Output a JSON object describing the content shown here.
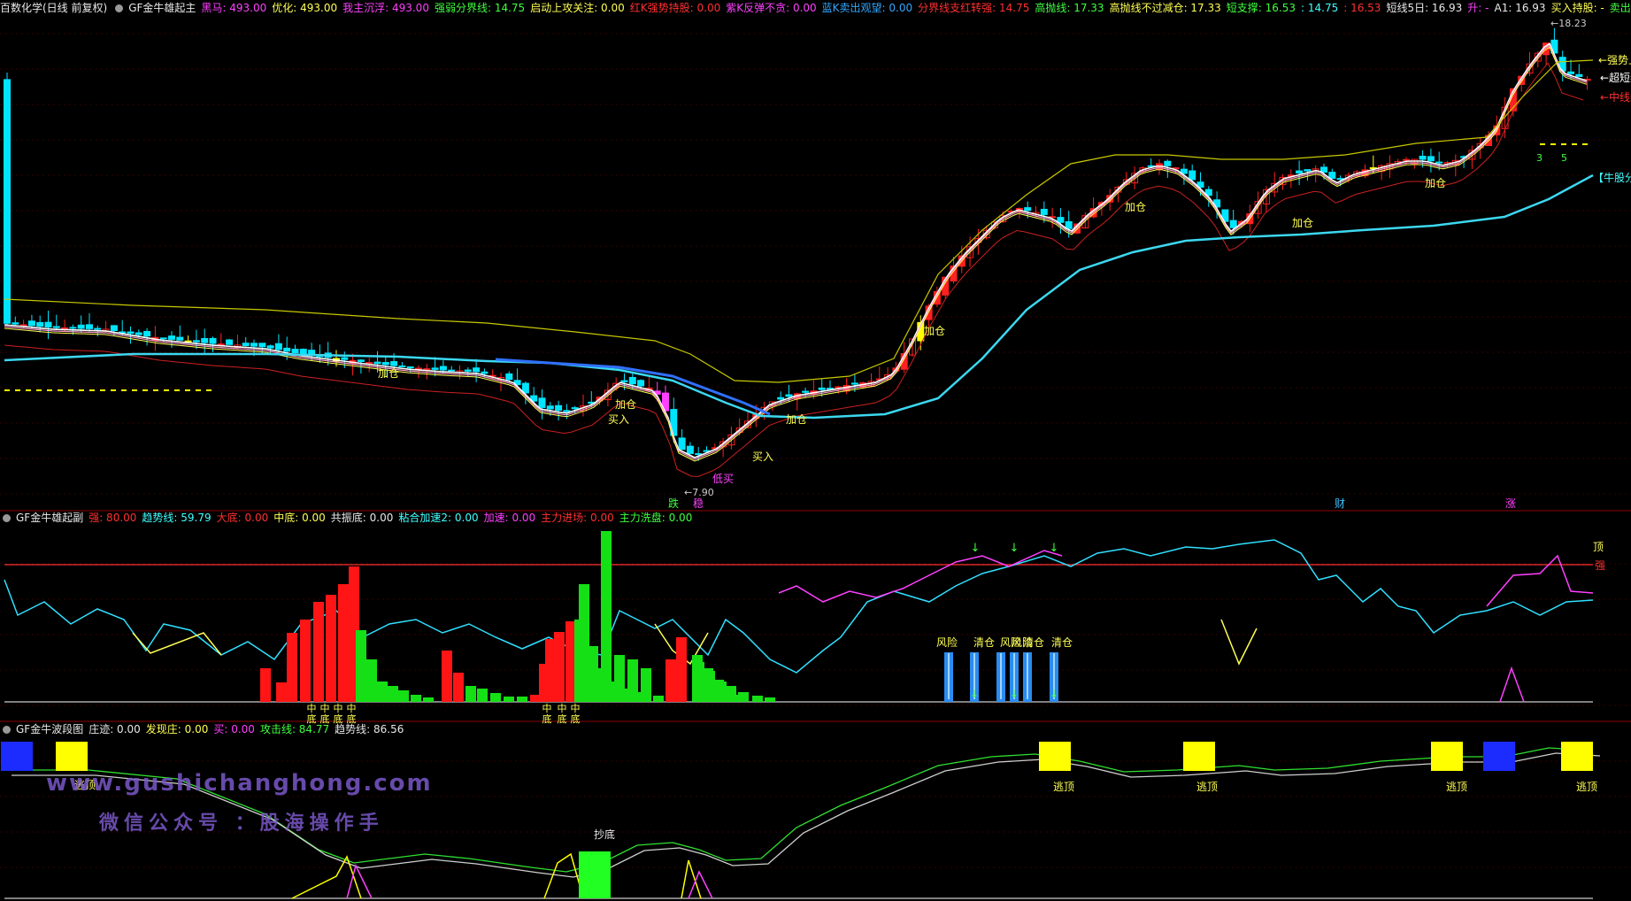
{
  "panel1": {
    "header": [
      {
        "text": "百数化学(日线 前复权)",
        "color": "#e8e8e8"
      },
      {
        "text": "GF金牛雄起主",
        "color": "#e8e8e8",
        "icon": true
      },
      {
        "text": "黑马: 493.00",
        "color": "#ff40ff"
      },
      {
        "text": "优化: 493.00",
        "color": "#ffff55"
      },
      {
        "text": "我主沉浮: 493.00",
        "color": "#ff40ff"
      },
      {
        "text": "强弱分界线: 14.75",
        "color": "#40ff40"
      },
      {
        "text": "启动上攻关注: 0.00",
        "color": "#ffff55"
      },
      {
        "text": "红K强势持股: 0.00",
        "color": "#ff3030"
      },
      {
        "text": "紫K反弹不贪: 0.00",
        "color": "#ff40ff"
      },
      {
        "text": "蓝K卖出观望: 0.00",
        "color": "#30a8ff"
      },
      {
        "text": "分界线支红转强: 14.75",
        "color": "#ff3030"
      },
      {
        "text": "高抛线: 17.33",
        "color": "#40ff40"
      },
      {
        "text": "高抛线不过减仓: 17.33",
        "color": "#ffff55"
      },
      {
        "text": "短支撑: 16.53",
        "color": "#40ff40"
      },
      {
        "text": ": 14.75",
        "color": "#40ffff"
      },
      {
        "text": ": 16.53",
        "color": "#ff3030"
      },
      {
        "text": "短线5日: 16.93",
        "color": "#e8e8e8"
      },
      {
        "text": "升: -",
        "color": "#ff40ff"
      },
      {
        "text": "A1: 16.93",
        "color": "#e8e8e8"
      },
      {
        "text": "买入持股: -",
        "color": "#ffff55"
      },
      {
        "text": "卖出空仓: -",
        "color": "#40ff40"
      }
    ],
    "labels": {
      "jiacang": "加仓",
      "mairu": "买入",
      "dimai": "低买",
      "diancang": "加仓",
      "low_price": "7.90",
      "high_price": "18.23",
      "die": "跌",
      "wen": "稳",
      "cai": "财",
      "zhang": "涨",
      "right_strong": "强势上",
      "right_ultra": "超短线",
      "right_mid": "中线线",
      "right_bull": "【牛股分",
      "num3": "3",
      "num5": "5"
    }
  },
  "panel2": {
    "header": [
      {
        "text": "GF金牛雄起副",
        "color": "#e8e8e8",
        "icon": true
      },
      {
        "text": "强: 80.00",
        "color": "#ff3030"
      },
      {
        "text": "趋势线: 59.79",
        "color": "#40ffff"
      },
      {
        "text": "大底: 0.00",
        "color": "#ff3030"
      },
      {
        "text": "中底: 0.00",
        "color": "#ffff55"
      },
      {
        "text": "共振底: 0.00",
        "color": "#e8e8e8"
      },
      {
        "text": "粘合加速2: 0.00",
        "color": "#40ffff"
      },
      {
        "text": "加速: 0.00",
        "color": "#ff40ff"
      },
      {
        "text": "主力进场: 0.00",
        "color": "#ff3030"
      },
      {
        "text": "主力洗盘: 0.00",
        "color": "#40ff40"
      }
    ],
    "labels": {
      "top": "顶",
      "strong": "强",
      "fengxian": "风险",
      "qingcang": "清仓",
      "zhong": "中",
      "di": "底"
    }
  },
  "panel3": {
    "header": [
      {
        "text": "GF金牛波段图",
        "color": "#e8e8e8",
        "icon": true
      },
      {
        "text": "庄迹: 0.00",
        "color": "#e8e8e8"
      },
      {
        "text": "发现庄: 0.00",
        "color": "#ffff55"
      },
      {
        "text": "买: 0.00",
        "color": "#ff40ff"
      },
      {
        "text": "攻击线: 84.77",
        "color": "#40ff40"
      },
      {
        "text": "趋势线: 86.56",
        "color": "#e8e8e8"
      }
    ],
    "labels": {
      "taoding": "逃顶",
      "chaodi": "抄底"
    }
  },
  "watermark": {
    "line1": "www.gushichanghong.com",
    "line2": "微信公众号 ：股海操作手"
  }
}
